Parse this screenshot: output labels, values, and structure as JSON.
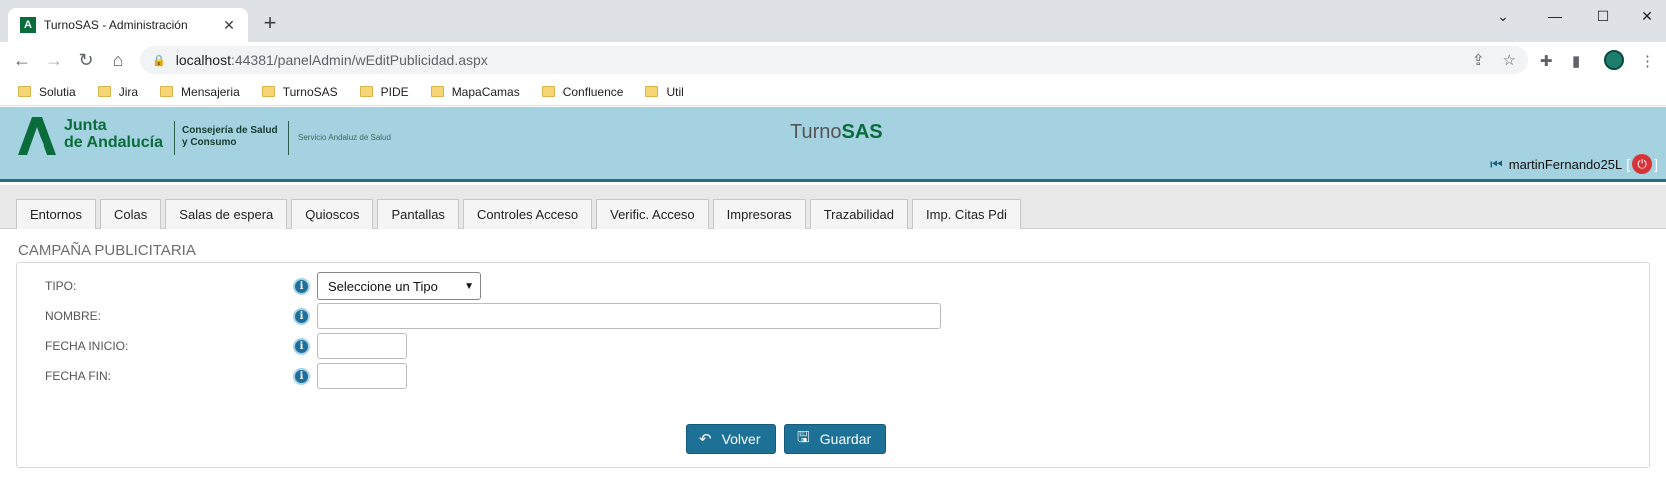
{
  "browser": {
    "tab_title": "TurnoSAS - Administración",
    "url_host": "localhost",
    "url_path": ":44381/panelAdmin/wEditPublicidad.aspx",
    "bookmarks": [
      "Solutia",
      "Jira",
      "Mensajeria",
      "TurnoSAS",
      "PIDE",
      "MapaCamas",
      "Confluence",
      "Util"
    ]
  },
  "header": {
    "logo_line1": "Junta",
    "logo_line2": "de Andalucía",
    "consejeria_line1": "Consejería de Salud",
    "consejeria_line2": "y Consumo",
    "sas": "Servicio Andaluz de Salud",
    "brand_plain": "Turno",
    "brand_bold": "SAS",
    "user": "martinFernando25L",
    "bracket_open": "[",
    "bracket_close": "]"
  },
  "nav": {
    "tabs": [
      "Entornos",
      "Colas",
      "Salas de espera",
      "Quioscos",
      "Pantallas",
      "Controles Acceso",
      "Verific. Acceso",
      "Impresoras",
      "Trazabilidad",
      "Imp. Citas Pdi"
    ]
  },
  "form": {
    "title": "CAMPAÑA PUBLICITARIA",
    "tipo_label": "TIPO:",
    "tipo_value": "Seleccione un Tipo",
    "nombre_label": "NOMBRE:",
    "nombre_value": "",
    "fecha_inicio_label": "FECHA INICIO:",
    "fecha_inicio_value": "",
    "fecha_fin_label": "FECHA FIN:",
    "fecha_fin_value": "",
    "volver_label": "Volver",
    "guardar_label": "Guardar"
  },
  "colors": {
    "header_bg": "#a4d2e1",
    "brand_green": "#0a6b3b",
    "button_blue": "#1d7196",
    "power_red": "#d9333a"
  }
}
